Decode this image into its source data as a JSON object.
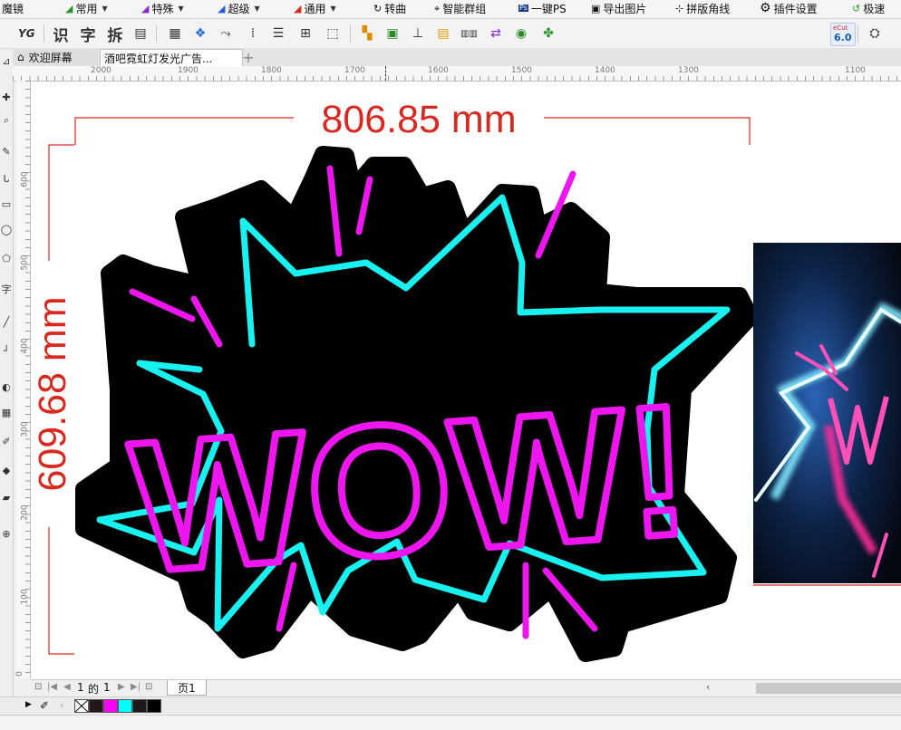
{
  "menubar": {
    "items": [
      {
        "label": "魔镜",
        "icon": "mirror-icon"
      },
      {
        "label": "常用",
        "icon": "common-tools-icon"
      },
      {
        "label": "特殊",
        "icon": "special-tools-icon"
      },
      {
        "label": "超级",
        "icon": "super-tools-icon"
      },
      {
        "label": "通用",
        "icon": "general-tools-icon"
      },
      {
        "label": "转曲",
        "icon": "convert-curve-icon"
      },
      {
        "label": "智能群组",
        "icon": "smart-group-icon"
      },
      {
        "label": "一键PS",
        "icon": "photoshop-icon"
      },
      {
        "label": "导出图片",
        "icon": "export-image-icon"
      },
      {
        "label": "拼版角线",
        "icon": "crop-marks-icon"
      },
      {
        "label": "插件设置",
        "icon": "gear-icon"
      },
      {
        "label": "极速",
        "icon": "undo-icon"
      }
    ]
  },
  "toolbar": {
    "yg_label": "YG",
    "shi_label": "识",
    "zi_label": "字",
    "chai_label": "拆",
    "ecut_label": "6.0",
    "ecut_top": "eCut"
  },
  "tabs": {
    "welcome": "欢迎屏幕",
    "document": "酒吧霓虹灯发光广告...",
    "add": "+"
  },
  "hruler": {
    "ticks": [
      "2000",
      "1900",
      "1800",
      "1700",
      "1600",
      "1500",
      "1400",
      "1300",
      "1100"
    ]
  },
  "vruler": {
    "ticks": [
      "600",
      "500",
      "400",
      "300",
      "200",
      "100",
      "0"
    ]
  },
  "canvas": {
    "dim_width": "806.85 mm",
    "dim_height": "609.68 mm",
    "neon_text": "WOW!"
  },
  "pagebar": {
    "page_counter_value": "1",
    "page_counter_of": "的",
    "page_counter_total": "1",
    "page_tab": "页1"
  },
  "colors": {
    "dimension_red": "#d9281f",
    "neon_cyan": "#19f0f0",
    "neon_magenta": "#ee16ee",
    "sign_black": "#000000"
  },
  "palette": {
    "swatches": [
      "#ffffff",
      "#231815",
      "#ff00ff",
      "#00ffff",
      "#1a1a1a",
      "#000000"
    ]
  }
}
